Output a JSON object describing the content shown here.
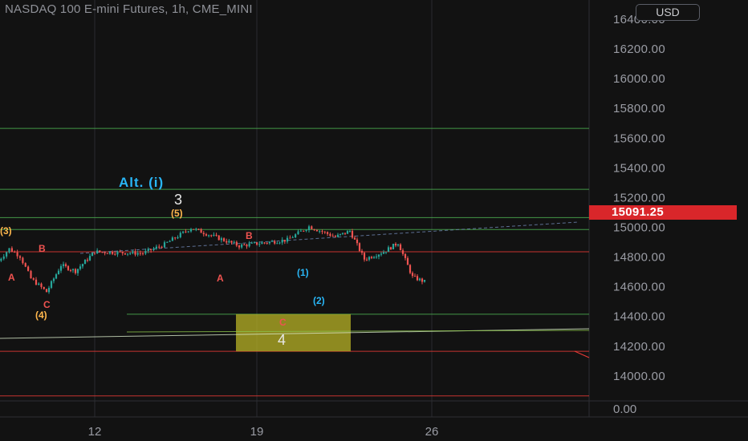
{
  "header": {
    "title": "NASDAQ 100 E-mini Futures, 1h, CME_MINI",
    "currency_label": "USD"
  },
  "colors": {
    "background": "#121212",
    "up": "#26a69a",
    "down": "#ef5350",
    "green_line": "#4caf50",
    "red_line": "#e53935",
    "cyan_label": "#29b6f6",
    "orange_label": "#ffb74d",
    "zone_fill": "#b8b326",
    "price_tag": "#d9262a"
  },
  "chart_data": {
    "type": "candlestick",
    "title": "NASDAQ 100 E-mini Futures, 1h, CME_MINI",
    "ylim": [
      13800,
      16550
    ],
    "y_ticks": [
      "16400.00",
      "16200.00",
      "16000.00",
      "15800.00",
      "15600.00",
      "15400.00",
      "15200.00",
      "15000.00",
      "14800.00",
      "14600.00",
      "14400.00",
      "14200.00",
      "14000.00"
    ],
    "x_ticks": [
      "12",
      "19",
      "26"
    ],
    "last_price": "15091.25",
    "indicator_pane_tick": "0.00",
    "price_path": [
      {
        "date": "Jul 10",
        "price": 14770
      },
      {
        "date": "Jul 10",
        "price": 14850
      },
      {
        "date": "Jul 10",
        "price": 14800
      },
      {
        "date": "Jul 10",
        "price": 14650
      },
      {
        "date": "Jul 11",
        "price": 14560
      },
      {
        "date": "Jul 11",
        "price": 14740
      },
      {
        "date": "Jul 11",
        "price": 14700
      },
      {
        "date": "Jul 12",
        "price": 14830
      },
      {
        "date": "Jul 13",
        "price": 14820
      },
      {
        "date": "Jul 13",
        "price": 14880
      },
      {
        "date": "Jul 14",
        "price": 14990
      },
      {
        "date": "Jul 15",
        "price": 14870
      },
      {
        "date": "Jul 16",
        "price": 14910
      },
      {
        "date": "Jul 16",
        "price": 15000
      },
      {
        "date": "Jul 17",
        "price": 14930
      },
      {
        "date": "Jul 17",
        "price": 14970
      },
      {
        "date": "Jul 17",
        "price": 14780
      },
      {
        "date": "Jul 18",
        "price": 14830
      },
      {
        "date": "Jul 18",
        "price": 14890
      },
      {
        "date": "Jul 18",
        "price": 14660
      },
      {
        "date": "Jul 19",
        "price": 14610
      },
      {
        "date": "Jul 19",
        "price": 14440
      },
      {
        "date": "Jul 20",
        "price": 14560
      },
      {
        "date": "Jul 20",
        "price": 14600
      },
      {
        "date": "Jul 21",
        "price": 14530
      },
      {
        "date": "Jul 21",
        "price": 14740
      },
      {
        "date": "Jul 22",
        "price": 14750
      },
      {
        "date": "Jul 22",
        "price": 14860
      },
      {
        "date": "Jul 23",
        "price": 14850
      },
      {
        "date": "Jul 24",
        "price": 14940
      },
      {
        "date": "Jul 24",
        "price": 15010
      },
      {
        "date": "Jul 25",
        "price": 14980
      },
      {
        "date": "Jul 25",
        "price": 15090
      }
    ],
    "horizontal_levels": [
      {
        "price": 15660,
        "color": "green"
      },
      {
        "price": 15250,
        "color": "green"
      },
      {
        "price": 15060,
        "color": "green"
      },
      {
        "price": 14980,
        "color": "green"
      },
      {
        "price": 14830,
        "color": "red"
      },
      {
        "price": 14410,
        "color": "green"
      },
      {
        "price": 14160,
        "color": "red"
      },
      {
        "price": 13860,
        "color": "red"
      }
    ],
    "wave_labels": [
      {
        "text": "Alt. (i)",
        "color": "cyan"
      },
      {
        "text": "3",
        "color": "white"
      },
      {
        "text": "(5)",
        "color": "orange"
      },
      {
        "text": "(3)",
        "color": "orange"
      },
      {
        "text": "B",
        "color": "red"
      },
      {
        "text": "A",
        "color": "red"
      },
      {
        "text": "C",
        "color": "red"
      },
      {
        "text": "(4)",
        "color": "orange"
      },
      {
        "text": "B",
        "color": "red"
      },
      {
        "text": "A",
        "color": "red"
      },
      {
        "text": "(1)",
        "color": "cyan"
      },
      {
        "text": "(2)",
        "color": "cyan"
      },
      {
        "text": "C",
        "color": "red"
      },
      {
        "text": "4",
        "color": "white"
      }
    ],
    "target_zone": {
      "price_top": 14410,
      "price_bottom": 14160
    }
  }
}
